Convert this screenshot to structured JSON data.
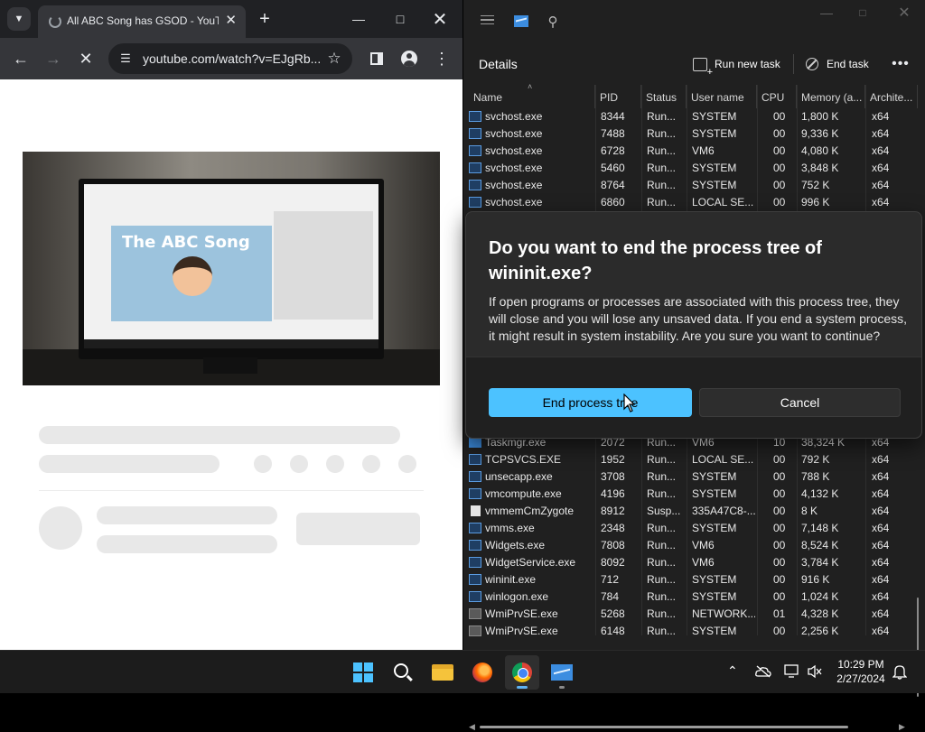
{
  "chrome": {
    "tab_title": "All ABC Song has GSOD - YouTube",
    "url": "youtube.com/watch?v=EJgRb..."
  },
  "taskmgr": {
    "page_title": "Details",
    "run_new_task": "Run new task",
    "end_task": "End task",
    "columns": [
      "Name",
      "PID",
      "Status",
      "User name",
      "CPU",
      "Memory (a...",
      "Archite..."
    ],
    "rows_top": [
      {
        "name": "svchost.exe",
        "pid": "8344",
        "status": "Run...",
        "user": "SYSTEM",
        "cpu": "00",
        "mem": "1,800 K",
        "arch": "x64",
        "icon": "exe"
      },
      {
        "name": "svchost.exe",
        "pid": "7488",
        "status": "Run...",
        "user": "SYSTEM",
        "cpu": "00",
        "mem": "9,336 K",
        "arch": "x64",
        "icon": "exe"
      },
      {
        "name": "svchost.exe",
        "pid": "6728",
        "status": "Run...",
        "user": "VM6",
        "cpu": "00",
        "mem": "4,080 K",
        "arch": "x64",
        "icon": "exe"
      },
      {
        "name": "svchost.exe",
        "pid": "5460",
        "status": "Run...",
        "user": "SYSTEM",
        "cpu": "00",
        "mem": "3,848 K",
        "arch": "x64",
        "icon": "exe"
      },
      {
        "name": "svchost.exe",
        "pid": "8764",
        "status": "Run...",
        "user": "SYSTEM",
        "cpu": "00",
        "mem": "752 K",
        "arch": "x64",
        "icon": "exe"
      },
      {
        "name": "svchost.exe",
        "pid": "6860",
        "status": "Run...",
        "user": "LOCAL SE...",
        "cpu": "00",
        "mem": "996 K",
        "arch": "x64",
        "icon": "exe"
      }
    ],
    "rows_bottom": [
      {
        "name": "Taskmgr.exe",
        "pid": "2072",
        "status": "Run...",
        "user": "VM6",
        "cpu": "10",
        "mem": "38,324 K",
        "arch": "x64",
        "icon": "tm"
      },
      {
        "name": "TCPSVCS.EXE",
        "pid": "1952",
        "status": "Run...",
        "user": "LOCAL SE...",
        "cpu": "00",
        "mem": "792 K",
        "arch": "x64",
        "icon": "exe"
      },
      {
        "name": "unsecapp.exe",
        "pid": "3708",
        "status": "Run...",
        "user": "SYSTEM",
        "cpu": "00",
        "mem": "788 K",
        "arch": "x64",
        "icon": "exe"
      },
      {
        "name": "vmcompute.exe",
        "pid": "4196",
        "status": "Run...",
        "user": "SYSTEM",
        "cpu": "00",
        "mem": "4,132 K",
        "arch": "x64",
        "icon": "exe"
      },
      {
        "name": "vmmemCmZygote",
        "pid": "8912",
        "status": "Susp...",
        "user": "335A47C8-...",
        "cpu": "00",
        "mem": "8 K",
        "arch": "x64",
        "icon": "doc"
      },
      {
        "name": "vmms.exe",
        "pid": "2348",
        "status": "Run...",
        "user": "SYSTEM",
        "cpu": "00",
        "mem": "7,148 K",
        "arch": "x64",
        "icon": "exe"
      },
      {
        "name": "Widgets.exe",
        "pid": "7808",
        "status": "Run...",
        "user": "VM6",
        "cpu": "00",
        "mem": "8,524 K",
        "arch": "x64",
        "icon": "exe"
      },
      {
        "name": "WidgetService.exe",
        "pid": "8092",
        "status": "Run...",
        "user": "VM6",
        "cpu": "00",
        "mem": "3,784 K",
        "arch": "x64",
        "icon": "exe"
      },
      {
        "name": "wininit.exe",
        "pid": "712",
        "status": "Run...",
        "user": "SYSTEM",
        "cpu": "00",
        "mem": "916 K",
        "arch": "x64",
        "icon": "exe"
      },
      {
        "name": "winlogon.exe",
        "pid": "784",
        "status": "Run...",
        "user": "SYSTEM",
        "cpu": "00",
        "mem": "1,024 K",
        "arch": "x64",
        "icon": "exe"
      },
      {
        "name": "WmiPrvSE.exe",
        "pid": "5268",
        "status": "Run...",
        "user": "NETWORK...",
        "cpu": "01",
        "mem": "4,328 K",
        "arch": "x64",
        "icon": "gear"
      },
      {
        "name": "WmiPrvSE.exe",
        "pid": "6148",
        "status": "Run...",
        "user": "SYSTEM",
        "cpu": "00",
        "mem": "2,256 K",
        "arch": "x64",
        "icon": "gear"
      }
    ]
  },
  "dialog": {
    "title": "Do you want to end the process tree of wininit.exe?",
    "body": "If open programs or processes are associated with this process tree, they will close and you will lose any unsaved data. If you end a system process, it might result in system instability. Are you sure you want to continue?",
    "confirm": "End process tree",
    "cancel": "Cancel"
  },
  "taskbar": {
    "time": "10:29 PM",
    "date": "2/27/2024"
  },
  "video_thumbnail": {
    "caption": "The ABC Song"
  },
  "colors": {
    "accent": "#4cc2ff",
    "tm_bg": "#202020",
    "chrome_frame": "#202124"
  },
  "icons": [
    "tab-list-icon",
    "new-tab-icon",
    "back-arrow-icon",
    "forward-arrow-icon",
    "stop-icon",
    "site-info-icon",
    "star-icon",
    "side-panel-icon",
    "profile-icon",
    "more-vert-icon",
    "hamburger-icon",
    "search-icon",
    "new-task-icon",
    "end-task-icon",
    "more-horiz-icon",
    "windows-start-icon",
    "explorer-icon",
    "firefox-icon",
    "chrome-icon",
    "task-manager-icon",
    "chevron-up-icon",
    "onedrive-icon",
    "network-icon",
    "volume-icon",
    "bell-icon"
  ]
}
